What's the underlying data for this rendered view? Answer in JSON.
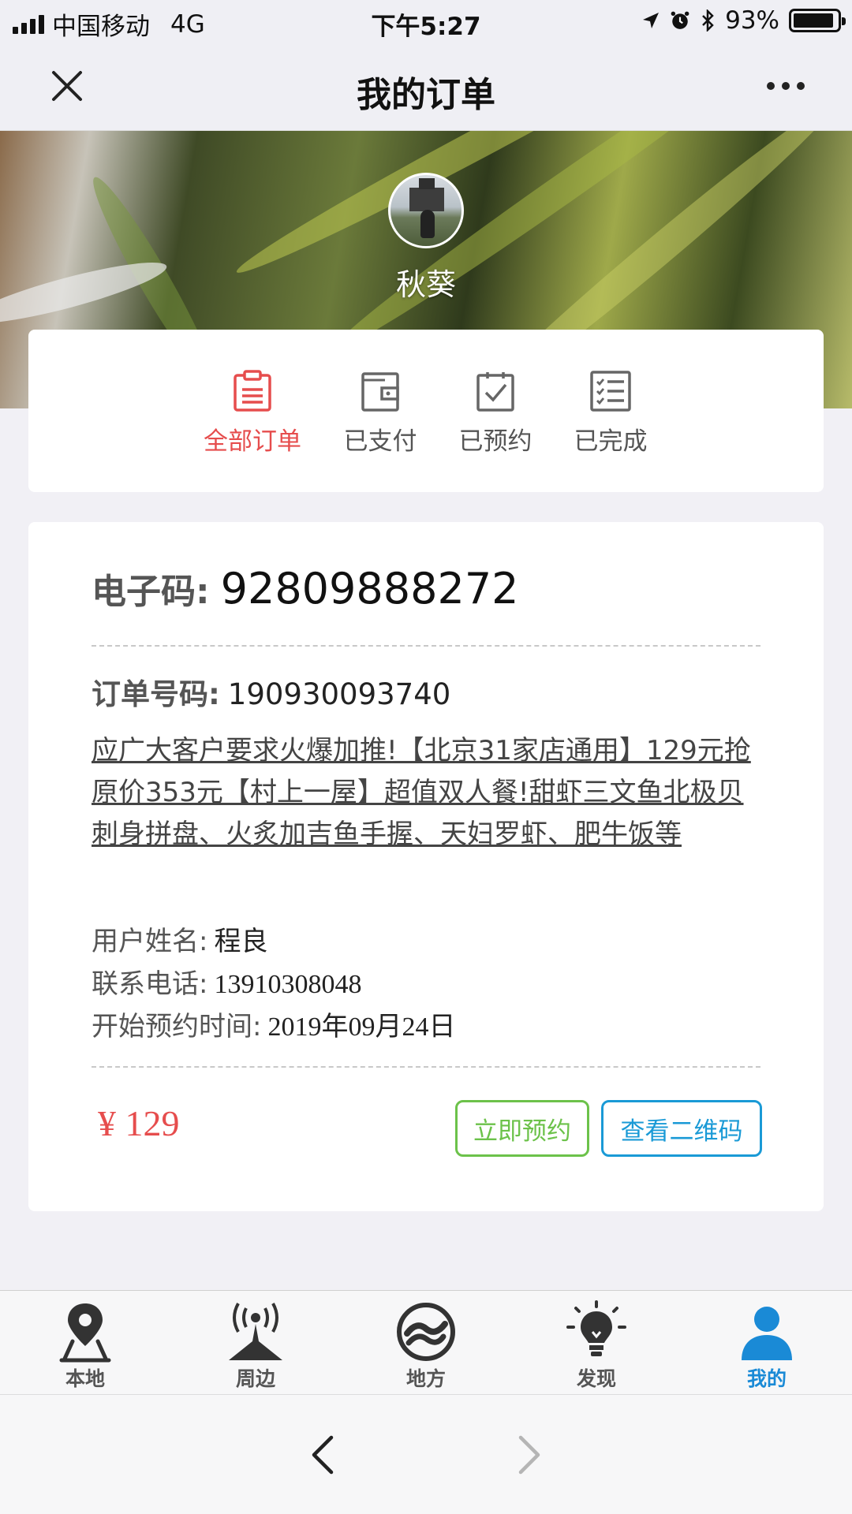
{
  "status_bar": {
    "carrier": "中国移动",
    "network": "4G",
    "time": "下午5:27",
    "battery": "93%",
    "battery_level": 0.93
  },
  "nav": {
    "title": "我的订单"
  },
  "profile": {
    "name": "秋葵"
  },
  "order_tabs": [
    {
      "label": "全部订单",
      "icon": "clipboard-icon",
      "active": true
    },
    {
      "label": "已支付",
      "icon": "wallet-icon",
      "active": false
    },
    {
      "label": "已预约",
      "icon": "calendar-check-icon",
      "active": false
    },
    {
      "label": "已完成",
      "icon": "checklist-icon",
      "active": false
    }
  ],
  "order": {
    "code_label": "电子码:",
    "code_value": "92809888272",
    "order_no_label": "订单号码:",
    "order_no_value": "190930093740",
    "description": "应广大客户要求火爆加推!【北京31家店通用】129元抢原价353元【村上一屋】超值双人餐!甜虾三文鱼北极贝刺身拼盘、火炙加吉鱼手握、天妇罗虾、肥牛饭等",
    "user_name_label": "用户姓名:",
    "user_name_value": "程良",
    "phone_label": "联系电话:",
    "phone_value": "13910308048",
    "start_time_label": "开始预约时间:",
    "start_time_value": "2019年09月24日",
    "price": "¥ 129",
    "book_button": "立即预约",
    "qr_button": "查看二维码"
  },
  "tabbar": [
    {
      "label": "本地",
      "icon": "location-pin-icon",
      "active": false
    },
    {
      "label": "周边",
      "icon": "broadcast-tower-icon",
      "active": false
    },
    {
      "label": "地方",
      "icon": "circle-logo-icon",
      "active": false
    },
    {
      "label": "发现",
      "icon": "lightbulb-icon",
      "active": false
    },
    {
      "label": "我的",
      "icon": "user-icon",
      "active": true
    }
  ],
  "colors": {
    "accent_red": "#e64d4d",
    "green": "#6cc24a",
    "blue": "#1a9ad6"
  }
}
